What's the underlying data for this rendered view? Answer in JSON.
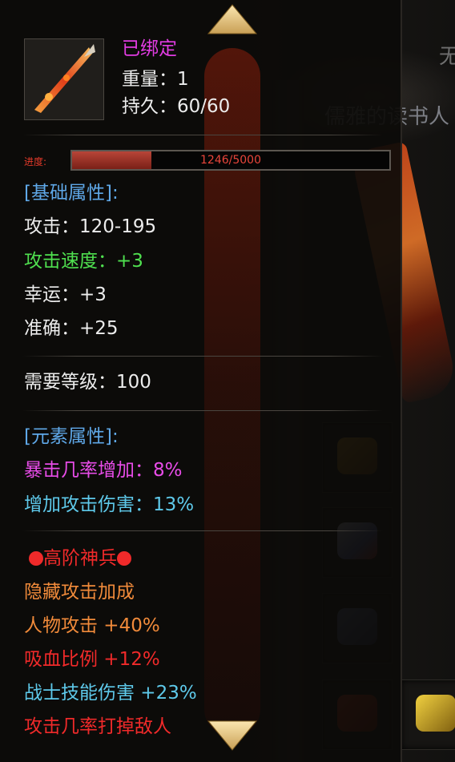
{
  "item": {
    "bound_status": "已绑定",
    "weight_label": "重量：",
    "weight_value": "1",
    "durability_label": "持久：",
    "durability_value": "60/60"
  },
  "progress": {
    "label": "进度:",
    "text": "1246/5000",
    "current": 1246,
    "max": 5000
  },
  "base_attrs": {
    "header": "[基础属性]:",
    "attack_label": "攻击：",
    "attack_value": "120-195",
    "attack_speed_label": "攻击速度：",
    "attack_speed_value": "+3",
    "luck_label": "幸运：",
    "luck_value": "+3",
    "accuracy_label": "准确：",
    "accuracy_value": "+25"
  },
  "requirement": {
    "label": "需要等级：",
    "value": "100"
  },
  "element_attrs": {
    "header": "[元素属性]:",
    "crit_label": "暴击几率增加：",
    "crit_value": "8%",
    "dmg_label": "增加攻击伤害：",
    "dmg_value": "13%"
  },
  "special": {
    "title": "高阶神兵",
    "hidden_bonus": "隐藏攻击加成",
    "char_attack": "人物攻击 +40%",
    "lifesteal": "吸血比例 +12%",
    "warrior_skill": "战士技能伤害 +23%",
    "drop_chance": "攻击几率打掉敌人"
  },
  "background": {
    "npc_title": "儒雅的读书人",
    "top_char": "无"
  },
  "colors": {
    "bound": "#e23ce2",
    "header_blue": "#5fa8e8",
    "green": "#4fe04f",
    "magenta": "#e84ce8",
    "cyan": "#5ec9ea",
    "red": "#f02a2a",
    "orange": "#f08a3a",
    "arrow_gold": "#e8c980"
  },
  "icons": {
    "scroll_up": "triangle-up-icon",
    "scroll_down": "triangle-down-icon",
    "weapon": "flame-spear-icon"
  }
}
